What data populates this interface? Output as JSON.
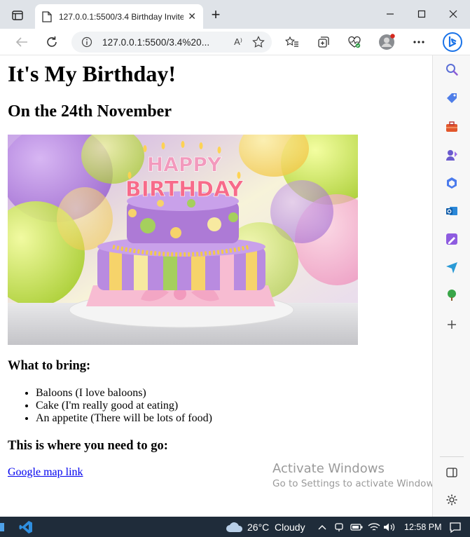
{
  "browser": {
    "tab_title": "127.0.0.1:5500/3.4 Birthday Invite",
    "tab_close": "✕",
    "new_tab": "+",
    "url": "127.0.0.1:5500/3.4%20...",
    "read_aloud": "A⁾"
  },
  "page": {
    "heading": "It's My Birthday!",
    "date": "On the 24th November",
    "image_text_top": "HAPPY",
    "image_text_bottom": "BIRTHDAY",
    "bring_heading": "What to bring:",
    "bring_items": [
      "Baloons (I love baloons)",
      "Cake (I'm really good at eating)",
      "An appetite (There will be lots of food)"
    ],
    "where_heading": "This is where you need to go:",
    "map_link": "Google map link"
  },
  "watermark": {
    "title": "Activate Windows",
    "subtitle": "Go to Settings to activate Windows."
  },
  "taskbar": {
    "temperature": "26°C",
    "weather": "Cloudy",
    "time": "12:58 PM"
  },
  "colors": {
    "accent_blue": "#1a73e8",
    "link": "#0000ee",
    "taskbar": "#1f2c3a"
  }
}
